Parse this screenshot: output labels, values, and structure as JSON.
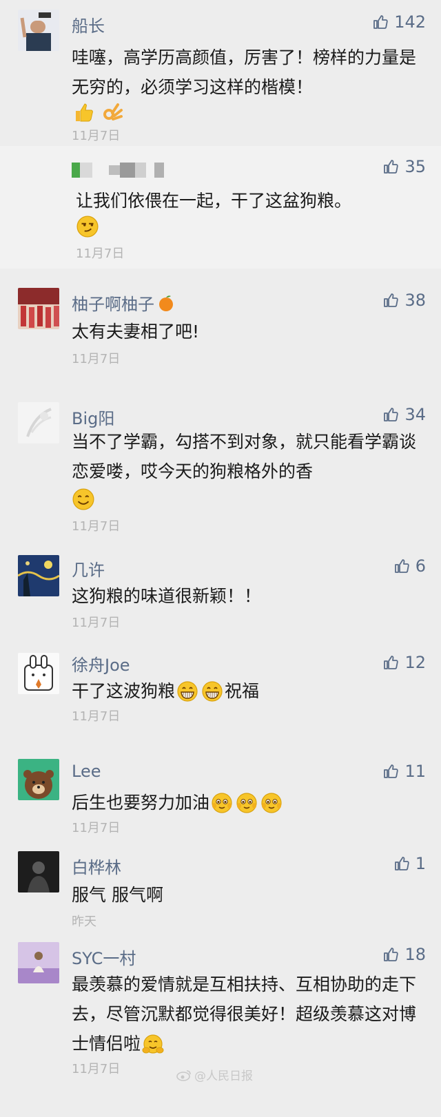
{
  "comments": [
    {
      "name": "船长",
      "likes": "142",
      "text": "哇噻，高学历高颜值，厉害了！榜样的力量是无穷的，必须学习这样的楷模！",
      "date": "11月7日"
    },
    {
      "name": "",
      "likes": "35",
      "text": "让我们依偎在一起，干了这盆狗粮。",
      "date": "11月7日"
    },
    {
      "name": "柚子啊柚子",
      "likes": "38",
      "text": "太有夫妻相了吧!",
      "date": "11月7日"
    },
    {
      "name": "Big阳",
      "likes": "34",
      "text": "当不了学霸，勾搭不到对象，就只能看学霸谈恋爱喽，哎今天的狗粮格外的香",
      "date": "11月7日"
    },
    {
      "name": "几许",
      "likes": "6",
      "text": "这狗粮的味道很新颖！！",
      "date": "11月7日"
    },
    {
      "name": "徐舟Joe",
      "likes": "12",
      "text_a": "干了这波狗粮",
      "text_b": "祝福",
      "date": "11月7日"
    },
    {
      "name": "Lee",
      "likes": "11",
      "text": "后生也要努力加油",
      "date": "11月7日"
    },
    {
      "name": "白桦林",
      "likes": "1",
      "text": "服气 服气啊",
      "date": "昨天"
    },
    {
      "name": "SYC一村",
      "likes": "18",
      "text": "最羡慕的爱情就是互相扶持、互相协助的走下去，尽管沉默都觉得很美好！超级羡慕这对博士情侣啦",
      "date": "11月7日"
    }
  ],
  "watermark": "@人民日报",
  "colors": {
    "name": "#5a6c87",
    "date": "#b4b4b4",
    "background": "#ededed",
    "reply_background": "#f2f2f2"
  },
  "icons": {
    "like": "thumbs-up-icon"
  }
}
